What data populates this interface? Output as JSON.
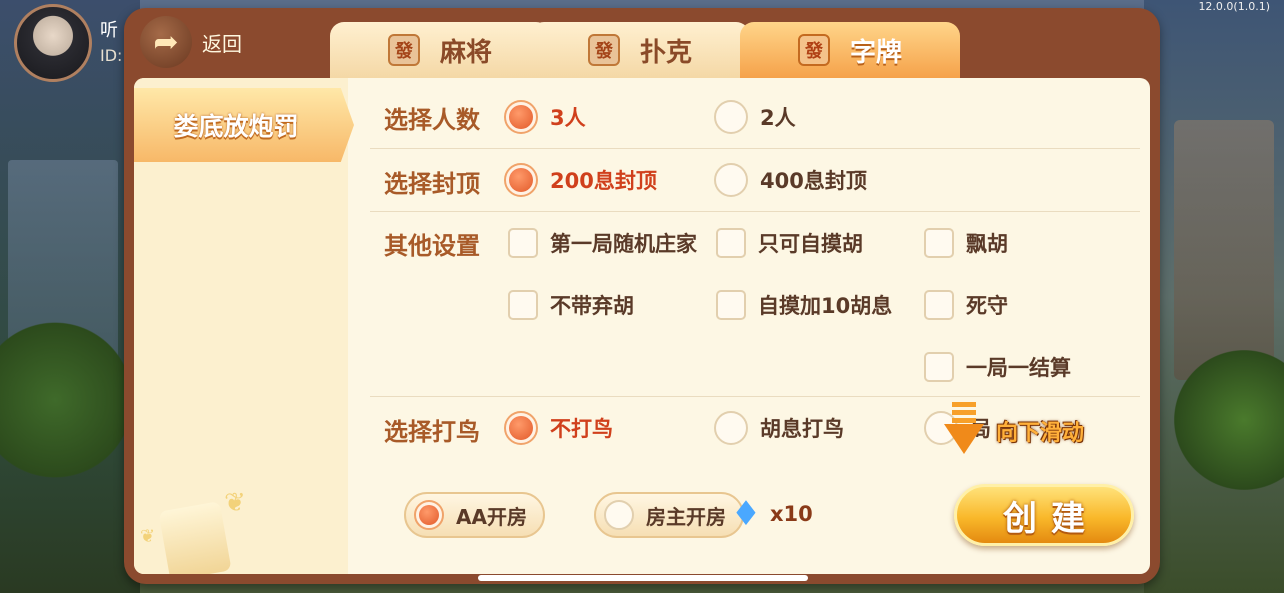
{
  "status": {
    "version": "12.0.0(1.0.1)"
  },
  "user": {
    "name": "听",
    "id_label": "ID:"
  },
  "back": {
    "label": "返回"
  },
  "tabs": [
    {
      "icon_glyph": "發",
      "label": "麻将"
    },
    {
      "icon_glyph": "發",
      "label": "扑克"
    },
    {
      "icon_glyph": "發",
      "label": "字牌"
    }
  ],
  "sidebar": {
    "items": [
      {
        "label": "娄底放炮罚"
      }
    ]
  },
  "settings": {
    "players": {
      "label": "选择人数",
      "options": [
        "3人",
        "2人"
      ],
      "selected": "3人"
    },
    "cap": {
      "label": "选择封顶",
      "options": [
        "200息封顶",
        "400息封顶"
      ],
      "selected": "200息封顶"
    },
    "other": {
      "label": "其他设置",
      "options": [
        "第一局随机庄家",
        "只可自摸胡",
        "飘胡",
        "不带弃胡",
        "自摸加10胡息",
        "死守",
        "一局一结算"
      ]
    },
    "bird": {
      "label": "选择打鸟",
      "options": [
        "不打鸟",
        "胡息打鸟",
        "局"
      ],
      "selected": "不打鸟"
    }
  },
  "payment": {
    "options": [
      "AA开房",
      "房主开房"
    ],
    "selected": "AA开房"
  },
  "cost": {
    "icon": "diamond-icon",
    "count": "x10"
  },
  "create": {
    "label": "创建"
  },
  "scroll_hint": {
    "label": "向下滑动"
  }
}
